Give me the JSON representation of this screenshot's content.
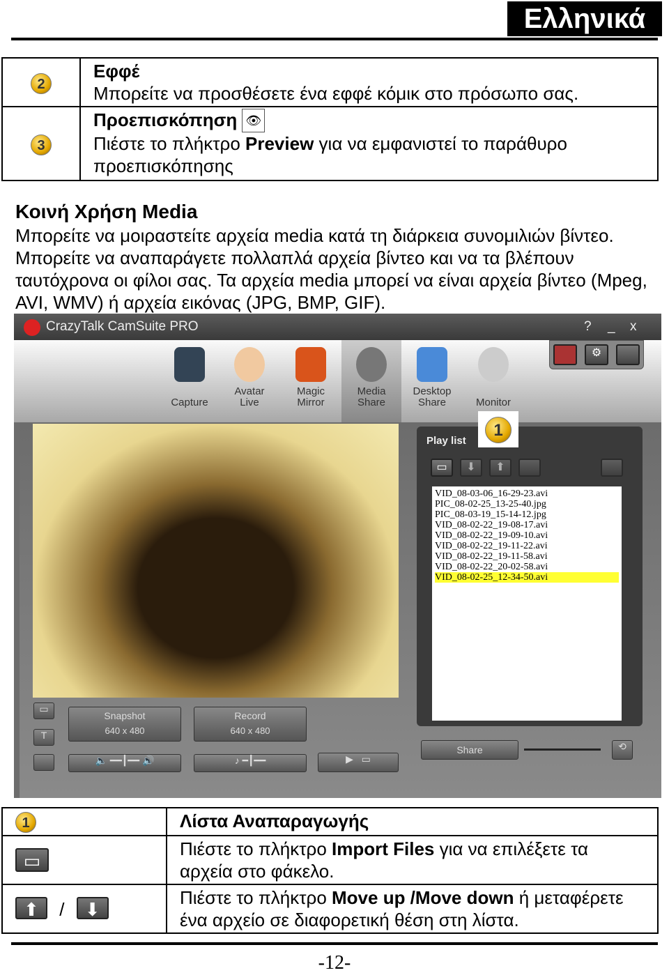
{
  "header": {
    "language": "Ελληνικά"
  },
  "table1": [
    {
      "badge": "2",
      "title": "Εφφέ",
      "text": "Μπορείτε να προσθέσετε ένα εφφέ κόμικ στο πρόσωπο σας."
    },
    {
      "badge": "3",
      "title": "Προεπισκόπηση",
      "icon": "preview-eye-icon",
      "text_before": "Πιέστε το πλήκτρο ",
      "bold": "Preview",
      "text_after": " για να εμφανιστεί το παράθυρο προεπισκόπησης"
    }
  ],
  "section": {
    "title": "Κοινή Χρήση Media",
    "body": "Μπορείτε να μοιραστείτε αρχεία media κατά τη διάρκεια συνομιλιών βίντεο. Μπορείτε να αναπαράγετε πολλαπλά αρχεία βίντεο και να τα βλέπουν ταυτόχρονα οι φίλοι σας. Τα αρχεία media μπορεί να είναι αρχεία βίντεο (Mpeg, AVI, WMV) ή αρχεία εικόνας (JPG, BMP, GIF)."
  },
  "app": {
    "title": "CrazyTalk CamSuite PRO",
    "window_buttons": [
      "?",
      "_",
      "x"
    ],
    "tools": [
      {
        "label": "Capture"
      },
      {
        "label": "Avatar\nLive"
      },
      {
        "label": "Magic\nMirror"
      },
      {
        "label": "Media\nShare",
        "active": true
      },
      {
        "label": "Desktop\nShare"
      },
      {
        "label": "Monitor"
      }
    ],
    "callout": "1",
    "playlist": {
      "title": "Play list",
      "files": [
        "VID_08-03-06_16-29-23.avi",
        "PIC_08-02-25_13-25-40.jpg",
        "PIC_08-03-19_15-14-12.jpg",
        "VID_08-02-22_19-08-17.avi",
        "VID_08-02-22_19-09-10.avi",
        "VID_08-02-22_19-11-22.avi",
        "VID_08-02-22_19-11-58.avi",
        "VID_08-02-22_20-02-58.avi",
        "VID_08-02-25_12-34-50.avi"
      ],
      "selected_index": 8,
      "highlight_color": "#ffff33",
      "share_label": "Share"
    },
    "snapshot": {
      "label": "Snapshot",
      "res": "640 x 480"
    },
    "record": {
      "label": "Record",
      "res": "640 x 480"
    }
  },
  "table2": [
    {
      "badge": "1",
      "title": "Λίστα Αναπαραγωγής"
    },
    {
      "icon": "import-files-icon",
      "text_before": "Πιέστε το πλήκτρο ",
      "bold": "Import Files",
      "text_after": " για να επιλέξετε τα αρχεία στο φάκελο."
    },
    {
      "icons": [
        "move-up-icon",
        "move-down-icon"
      ],
      "sep": "/",
      "text_before": "Πιέστε το πλήκτρο ",
      "bold": "Move up /Move down",
      "text_after": " ή μεταφέρετε ένα αρχείο σε διαφορετική θέση στη λίστα."
    }
  ],
  "footer": {
    "page": "-12-"
  }
}
